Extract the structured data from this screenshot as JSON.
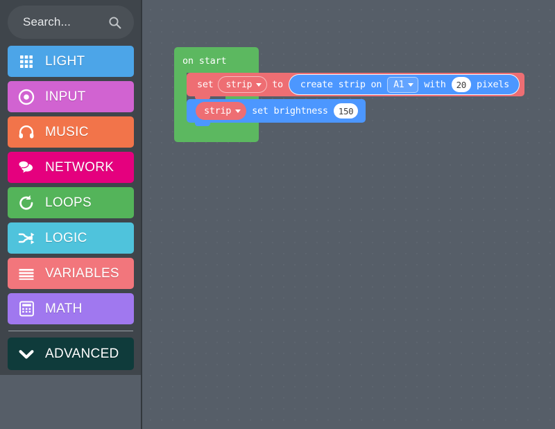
{
  "search": {
    "placeholder": "Search...",
    "value": "",
    "icon": "search-icon"
  },
  "sidebar": {
    "items": [
      {
        "id": "light",
        "label": "LIGHT",
        "color": "#4CA5E8",
        "icon": "grid-dots-icon"
      },
      {
        "id": "input",
        "label": "INPUT",
        "color": "#D163D1",
        "icon": "target-dot-icon"
      },
      {
        "id": "music",
        "label": "MUSIC",
        "color": "#F2744A",
        "icon": "headphones-icon"
      },
      {
        "id": "network",
        "label": "NETWORK",
        "color": "#E5007E",
        "icon": "speech-bubbles-icon"
      },
      {
        "id": "loops",
        "label": "LOOPS",
        "color": "#54B45A",
        "icon": "loop-arrow-icon"
      },
      {
        "id": "logic",
        "label": "LOGIC",
        "color": "#4FC3DC",
        "icon": "shuffle-arrows-icon"
      },
      {
        "id": "variables",
        "label": "VARIABLES",
        "color": "#F2767C",
        "icon": "lines-stack-icon"
      },
      {
        "id": "math",
        "label": "MATH",
        "color": "#A078EF",
        "icon": "calculator-icon"
      }
    ],
    "advanced": {
      "id": "advanced",
      "label": "ADVANCED",
      "color": "#0F3B3B",
      "icon": "chevron-down-icon"
    }
  },
  "workspace": {
    "on_start": {
      "label": "on start",
      "color": "#5CB860"
    },
    "set_block": {
      "color": "#EE6E73",
      "word_set": "set",
      "variable": "strip",
      "word_to": "to",
      "reporter": {
        "color": "#4C97FF",
        "text_create": "create strip on",
        "pin": "A1",
        "word_with": "with",
        "pixels": "20",
        "word_pixels": "pixels"
      }
    },
    "brightness_block": {
      "color": "#4C97FF",
      "variable": "strip",
      "label": "set brightness",
      "value": "150"
    }
  }
}
